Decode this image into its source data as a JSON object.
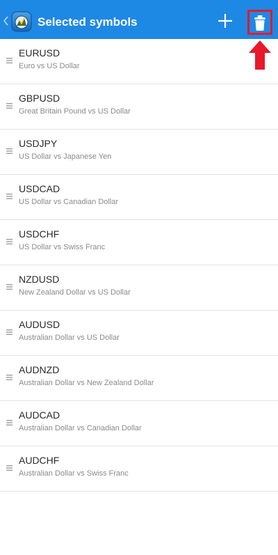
{
  "header": {
    "title": "Selected symbols",
    "back_icon": "chevron-left-icon",
    "logo_icon": "metatrader-app-icon",
    "add_icon": "plus-icon",
    "delete_icon": "trash-icon",
    "background_color": "#1e88e5"
  },
  "annotation": {
    "highlight_color": "#e8192a",
    "highlight_target": "delete-button",
    "arrow_icon": "arrow-up-icon"
  },
  "symbols": [
    {
      "symbol": "EURUSD",
      "description": "Euro vs US Dollar"
    },
    {
      "symbol": "GBPUSD",
      "description": "Great Britain Pound vs US Dollar"
    },
    {
      "symbol": "USDJPY",
      "description": "US Dollar vs Japanese Yen"
    },
    {
      "symbol": "USDCAD",
      "description": "US Dollar vs Canadian Dollar"
    },
    {
      "symbol": "USDCHF",
      "description": "US Dollar vs Swiss Franc"
    },
    {
      "symbol": "NZDUSD",
      "description": "New Zealand Dollar vs US Dollar"
    },
    {
      "symbol": "AUDUSD",
      "description": "Australian Dollar vs US Dollar"
    },
    {
      "symbol": "AUDNZD",
      "description": "Australian Dollar vs New Zealand Dollar"
    },
    {
      "symbol": "AUDCAD",
      "description": "Australian Dollar vs Canadian Dollar"
    },
    {
      "symbol": "AUDCHF",
      "description": "Australian Dollar vs Swiss Franc"
    }
  ],
  "row_handle_icon": "drag-handle-icon"
}
